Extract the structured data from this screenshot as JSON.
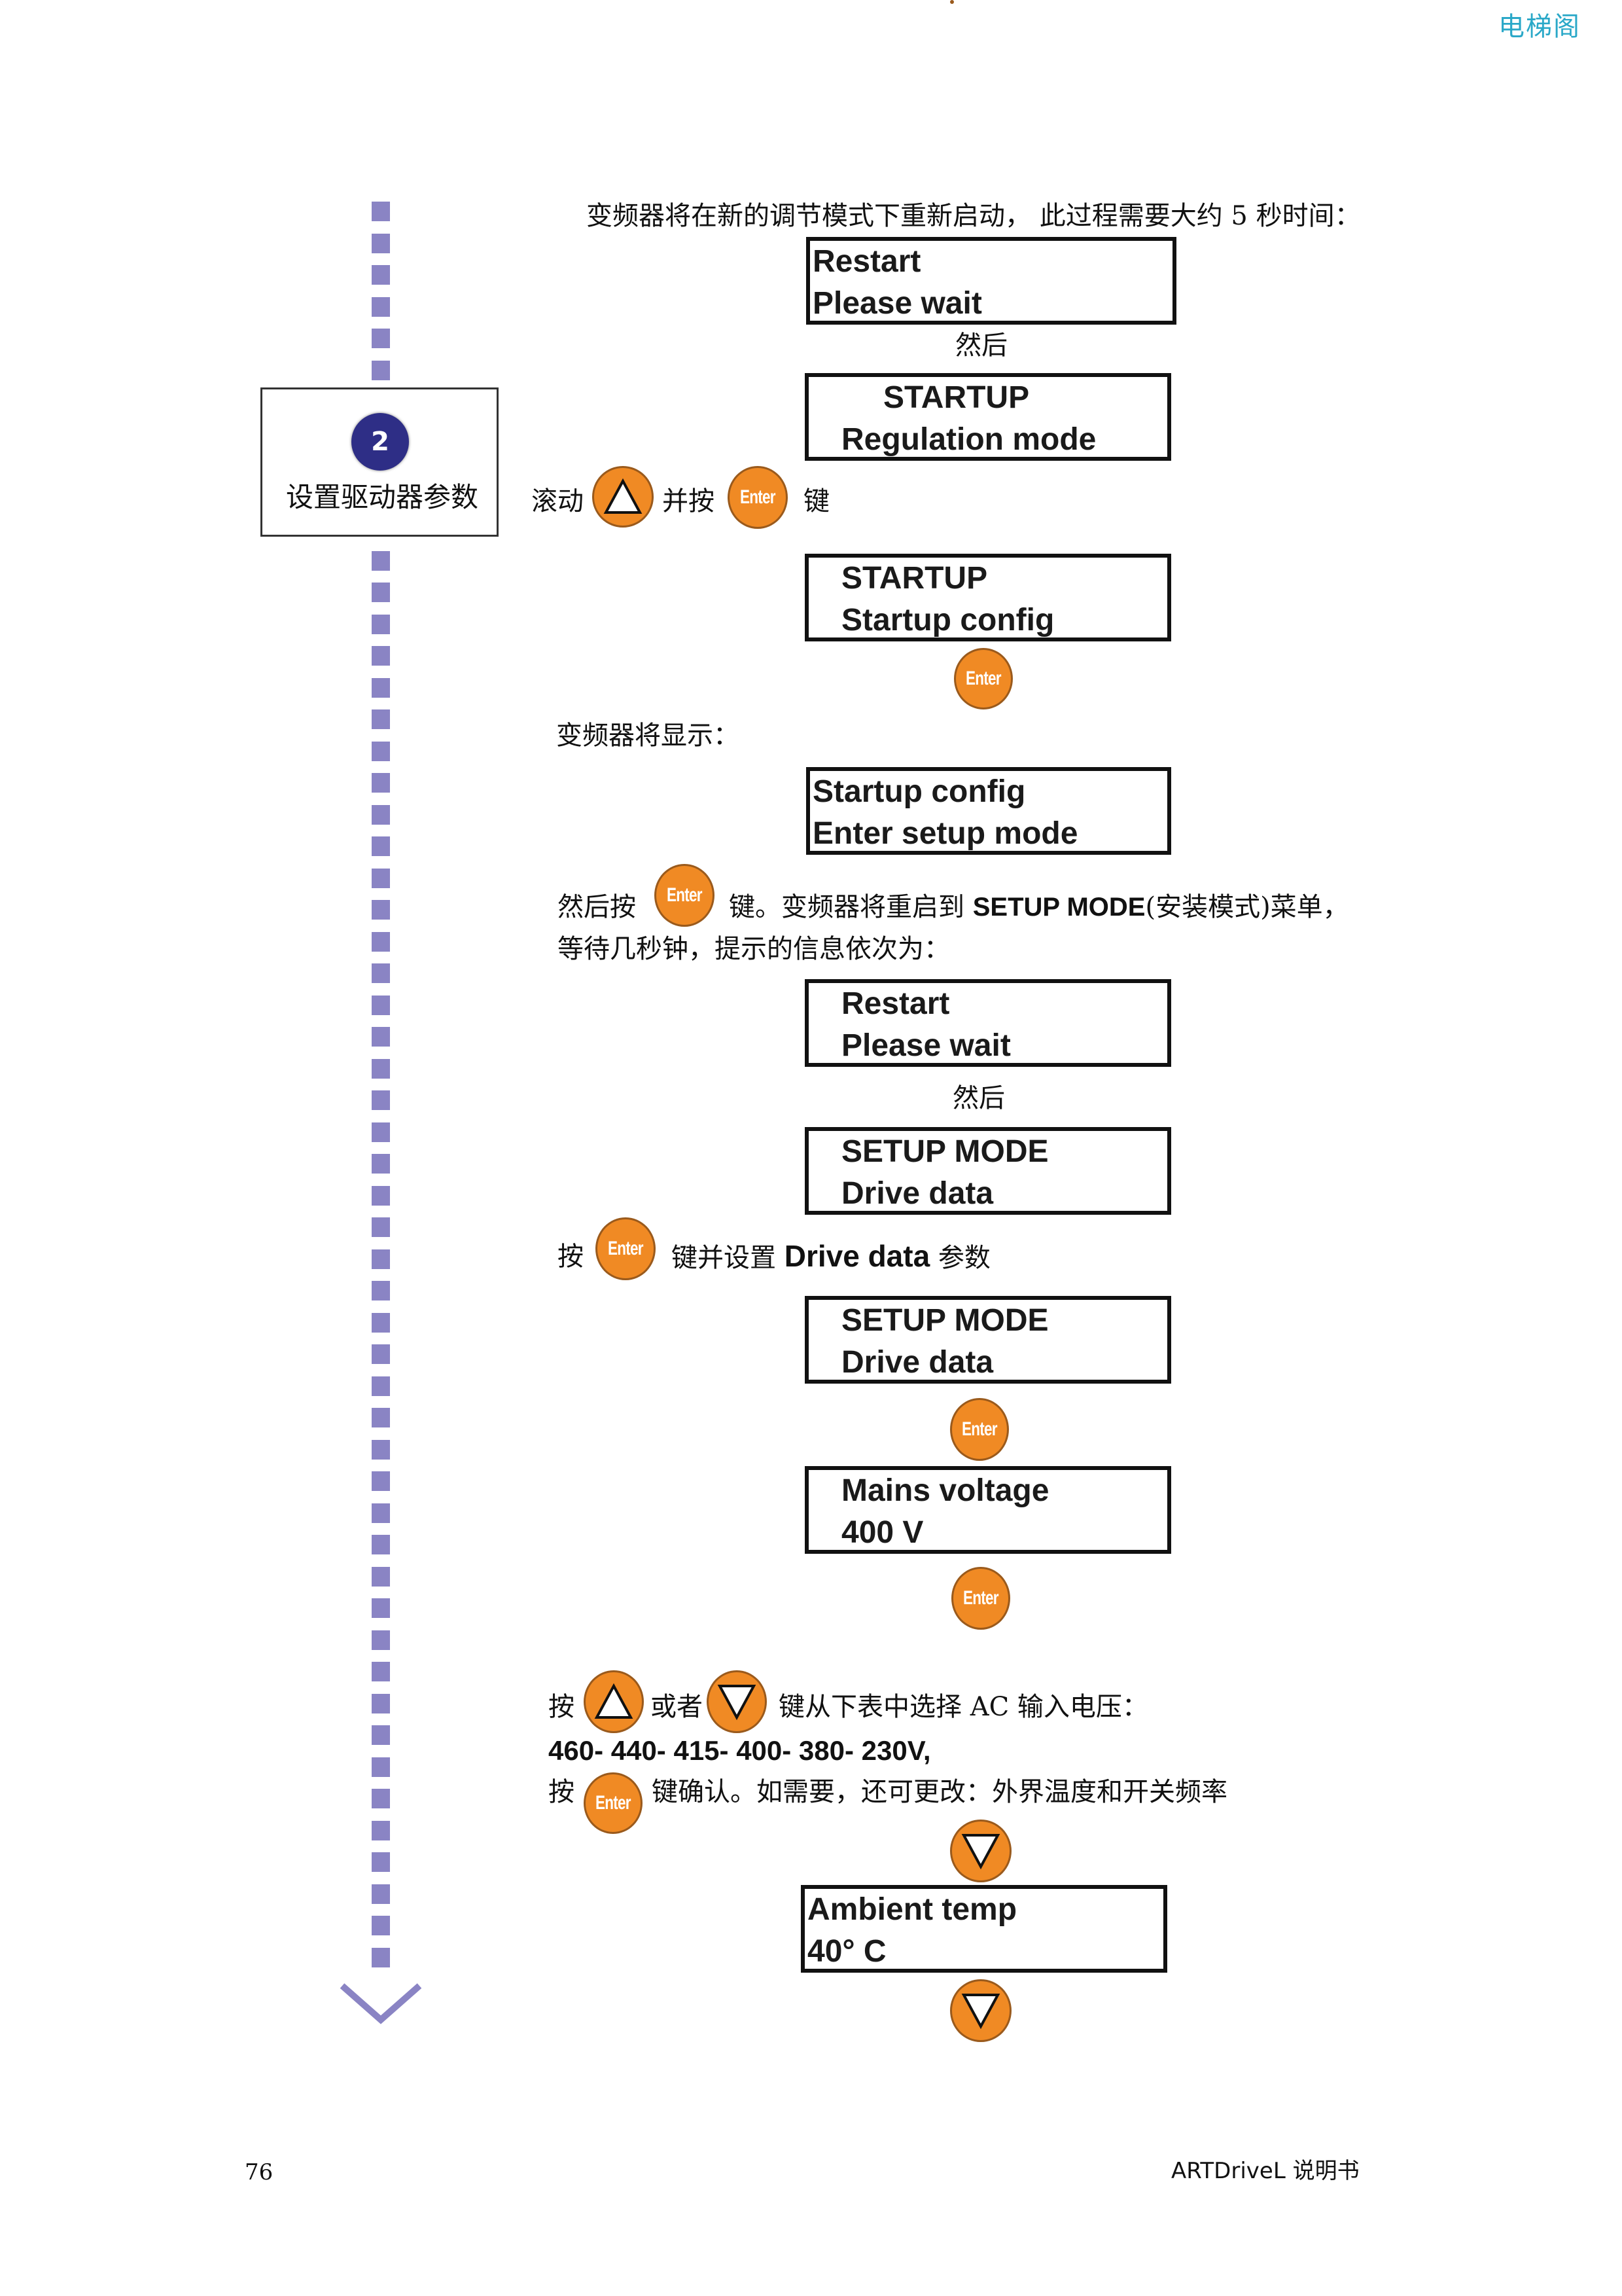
{
  "header": {
    "watermark": "电梯阁"
  },
  "step": {
    "number": "2",
    "title": "设置驱动器参数"
  },
  "texts": {
    "intro_restart": "变频器将在新的调节模式下重新启动， 此过程需要大约 5 秒时间：",
    "then_1": "然后",
    "scroll_prefix": "滚动",
    "scroll_middle": "并按",
    "scroll_suffix": "键",
    "will_display": "变频器将显示：",
    "then_press": "然后按",
    "restart_to_prefix": "键。变频器将重启到 ",
    "restart_to_bold": "SETUP MODE",
    "restart_to_suffix": "(安装模式)菜单，",
    "wait_seconds": "等待几秒钟，提示的信息依次为：",
    "then_2": "然后",
    "press_prefix": "按",
    "press_set_prefix": "键并设置 ",
    "press_set_bold": "Drive data",
    "press_set_suffix": " 参数",
    "select_prefix": "按",
    "select_or": "或者",
    "select_suffix": "键从下表中选择 AC 输入电压：",
    "voltage_list": "460- 440- 415- 400- 380- 230V,",
    "confirm_prefix": "按",
    "confirm_suffix": "键确认。如需要，还可更改：外界温度和开关频率"
  },
  "lcd_screens": [
    {
      "line1": "Restart",
      "line2": "Please wait"
    },
    {
      "line1": "STARTUP",
      "line2": "Regulation mode"
    },
    {
      "line1": "STARTUP",
      "line2": "Startup config"
    },
    {
      "line1": "Startup config",
      "line2": "Enter setup mode"
    },
    {
      "line1": "Restart",
      "line2": "Please wait"
    },
    {
      "line1": "SETUP MODE",
      "line2": "Drive data"
    },
    {
      "line1": "SETUP MODE",
      "line2": "Drive data"
    },
    {
      "line1": "Mains voltage",
      "line2": "400 V"
    },
    {
      "line1": "Ambient temp",
      "line2": "40° C"
    }
  ],
  "keys": {
    "enter_label": "Enter",
    "up_icon": "up-arrow-icon",
    "down_icon": "down-arrow-icon"
  },
  "colors": {
    "key_orange": "#f08a24",
    "flow_purple": "#8a84c4",
    "step_navy": "#2e2e86",
    "watermark": "#2aa8c8"
  },
  "footer": {
    "page_number": "76",
    "manual_title": "ARTDriveL 说明书"
  }
}
